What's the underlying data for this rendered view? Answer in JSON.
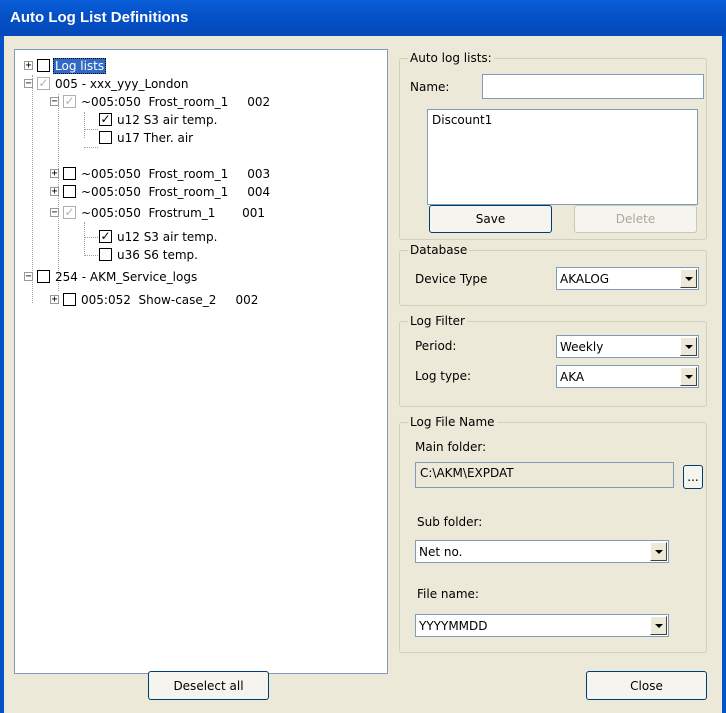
{
  "window": {
    "title": "Auto Log List Definitions"
  },
  "tree": {
    "root": "Log lists",
    "net1": "005 - xxx_yyy_London",
    "n1a": "~005:050  Frost_room_1     002",
    "n1a_c1": "u12 S3 air temp.",
    "n1a_c2": "u17 Ther. air",
    "n1b": "~005:050  Frost_room_1     003",
    "n1c": "~005:050  Frost_room_1     004",
    "n1d": "~005:050  Frostrum_1       001",
    "n1d_c1": "u12 S3 air temp.",
    "n1d_c2": "u36 S6 temp.",
    "net2": "254 - AKM_Service_logs",
    "n2a": "005:052  Show-case_2     002"
  },
  "autolog": {
    "group_title": "Auto log lists:",
    "name_label": "Name:",
    "name_value": "",
    "list_items": [
      "Discount1"
    ],
    "save_label": "Save",
    "delete_label": "Delete"
  },
  "database": {
    "group_title": "Database",
    "device_type_label": "Device Type",
    "device_type_value": "AKALOG"
  },
  "filter": {
    "group_title": "Log Filter",
    "period_label": "Period:",
    "period_value": "Weekly",
    "logtype_label": "Log type:",
    "logtype_value": "AKA"
  },
  "logfile": {
    "group_title": "Log File Name",
    "main_folder_label": "Main folder:",
    "main_folder_value": "C:\\AKM\\EXPDAT",
    "browse_label": "...",
    "sub_folder_label": "Sub folder:",
    "sub_folder_value": "Net no.",
    "file_name_label": "File name:",
    "file_name_value": "YYYYMMDD"
  },
  "footer": {
    "deselect_label": "Deselect all",
    "close_label": "Close"
  }
}
